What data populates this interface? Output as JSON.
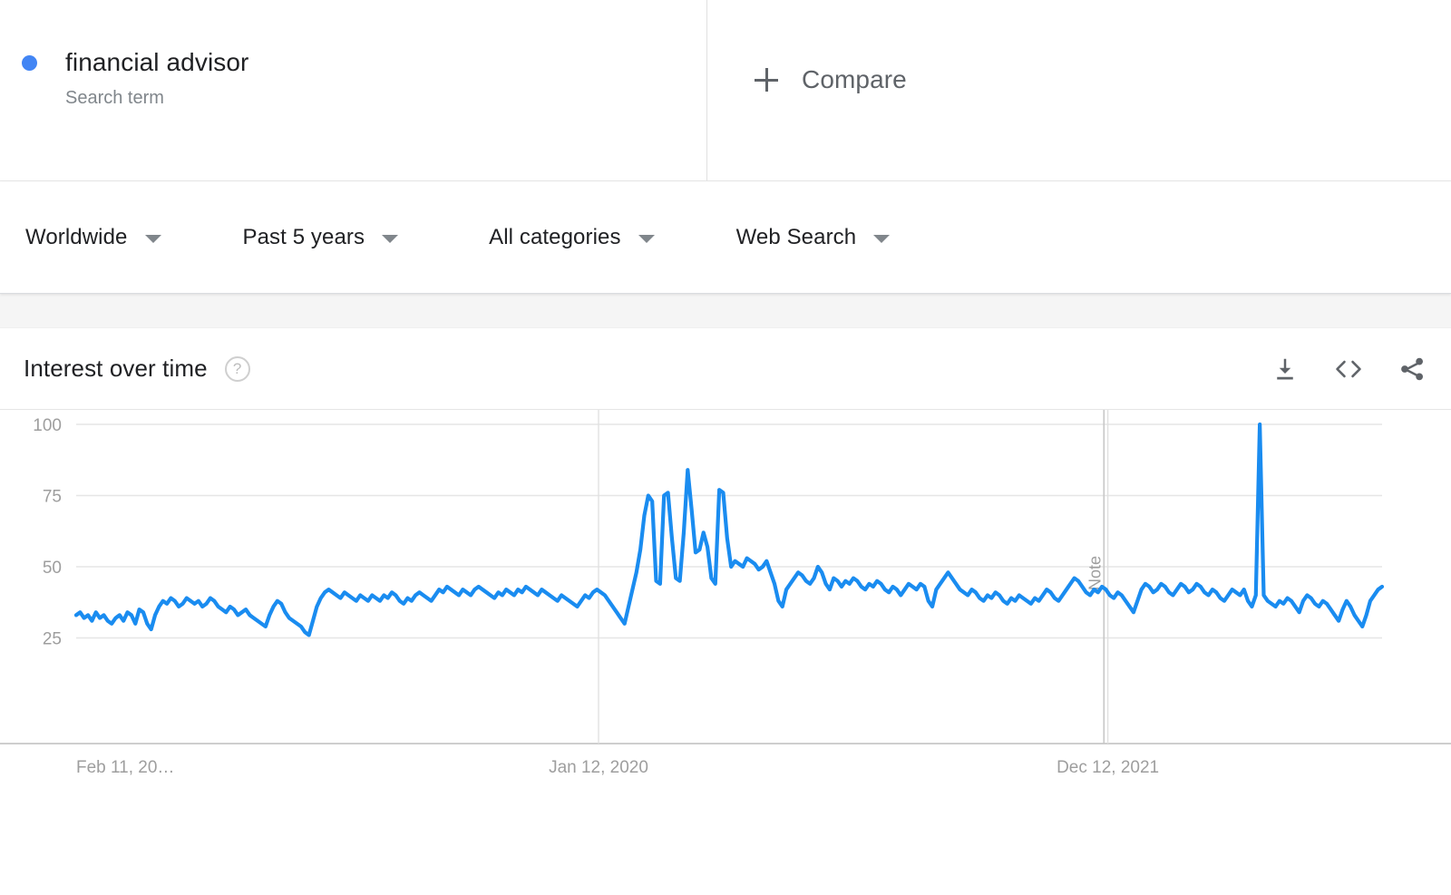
{
  "term": {
    "title": "financial advisor",
    "subtitle": "Search term",
    "dot_color": "#4285f4"
  },
  "compare": {
    "label": "Compare",
    "icon": "plus-icon"
  },
  "filters": [
    {
      "label": "Worldwide",
      "name": "geo"
    },
    {
      "label": "Past 5 years",
      "name": "time"
    },
    {
      "label": "All categories",
      "name": "category"
    },
    {
      "label": "Web Search",
      "name": "search-type"
    }
  ],
  "card": {
    "title": "Interest over time",
    "help_glyph": "?",
    "actions": [
      {
        "name": "download-icon",
        "tooltip": "Download"
      },
      {
        "name": "embed-code-icon",
        "tooltip": "Embed"
      },
      {
        "name": "share-icon",
        "tooltip": "Share"
      }
    ]
  },
  "chart_data": {
    "type": "line",
    "title": "Interest over time",
    "xlabel": "",
    "ylabel": "",
    "ylim": [
      0,
      100
    ],
    "yticks": [
      100,
      75,
      50,
      25
    ],
    "grid": true,
    "legend": "none",
    "line_color": "#1a8cf0",
    "xtick_labels": [
      "Feb 11, 20…",
      "Jan 12, 2020",
      "Dec 12, 2021"
    ],
    "xtick_positions": [
      0,
      0.4,
      0.79
    ],
    "annotations": [
      {
        "label": "Note",
        "x_fraction": 0.787,
        "orientation": "vertical"
      }
    ],
    "series": [
      {
        "name": "financial advisor",
        "color": "#1a8cf0",
        "values": [
          33,
          34,
          32,
          33,
          31,
          34,
          32,
          33,
          31,
          30,
          32,
          33,
          31,
          34,
          33,
          30,
          35,
          34,
          30,
          28,
          33,
          36,
          38,
          37,
          39,
          38,
          36,
          37,
          39,
          38,
          37,
          38,
          36,
          37,
          39,
          38,
          36,
          35,
          34,
          36,
          35,
          33,
          34,
          35,
          33,
          32,
          31,
          30,
          29,
          33,
          36,
          38,
          37,
          34,
          32,
          31,
          30,
          29,
          27,
          26,
          31,
          36,
          39,
          41,
          42,
          41,
          40,
          39,
          41,
          40,
          39,
          38,
          40,
          39,
          38,
          40,
          39,
          38,
          40,
          39,
          41,
          40,
          38,
          37,
          39,
          38,
          40,
          41,
          40,
          39,
          38,
          40,
          42,
          41,
          43,
          42,
          41,
          40,
          42,
          41,
          40,
          42,
          43,
          42,
          41,
          40,
          39,
          41,
          40,
          42,
          41,
          40,
          42,
          41,
          43,
          42,
          41,
          40,
          42,
          41,
          40,
          39,
          38,
          40,
          39,
          38,
          37,
          36,
          38,
          40,
          39,
          41,
          42,
          41,
          40,
          38,
          36,
          34,
          32,
          30,
          36,
          42,
          48,
          56,
          68,
          75,
          73,
          45,
          44,
          75,
          76,
          60,
          46,
          45,
          62,
          84,
          70,
          55,
          56,
          62,
          57,
          46,
          44,
          77,
          76,
          60,
          50,
          52,
          51,
          50,
          53,
          52,
          51,
          49,
          50,
          52,
          48,
          44,
          38,
          36,
          42,
          44,
          46,
          48,
          47,
          45,
          44,
          46,
          50,
          48,
          44,
          42,
          46,
          45,
          43,
          45,
          44,
          46,
          45,
          43,
          42,
          44,
          43,
          45,
          44,
          42,
          41,
          43,
          42,
          40,
          42,
          44,
          43,
          42,
          44,
          43,
          38,
          36,
          42,
          44,
          46,
          48,
          46,
          44,
          42,
          41,
          40,
          42,
          41,
          39,
          38,
          40,
          39,
          41,
          40,
          38,
          37,
          39,
          38,
          40,
          39,
          38,
          37,
          39,
          38,
          40,
          42,
          41,
          39,
          38,
          40,
          42,
          44,
          46,
          45,
          43,
          41,
          40,
          42,
          41,
          43,
          42,
          40,
          39,
          41,
          40,
          38,
          36,
          34,
          38,
          42,
          44,
          43,
          41,
          42,
          44,
          43,
          41,
          40,
          42,
          44,
          43,
          41,
          42,
          44,
          43,
          41,
          40,
          42,
          41,
          39,
          38,
          40,
          42,
          41,
          40,
          42,
          38,
          36,
          40,
          100,
          40,
          38,
          37,
          36,
          38,
          37,
          39,
          38,
          36,
          34,
          38,
          40,
          39,
          37,
          36,
          38,
          37,
          35,
          33,
          31,
          35,
          38,
          36,
          33,
          31,
          29,
          33,
          38,
          40,
          42,
          43
        ]
      }
    ]
  }
}
